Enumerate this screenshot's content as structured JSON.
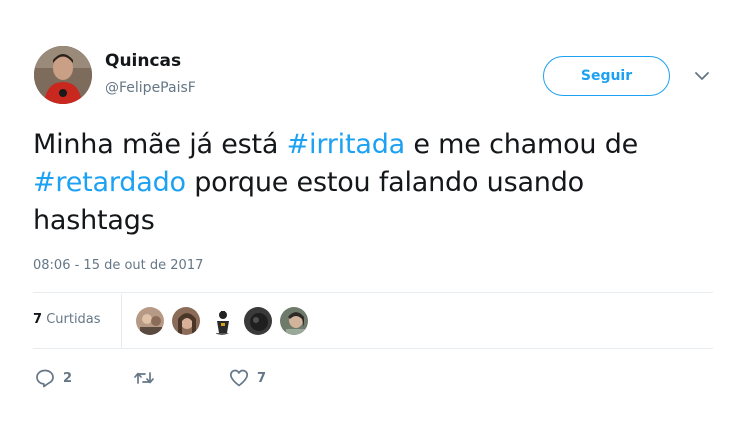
{
  "author": {
    "name": "Quincas",
    "handle": "@FelipePaisF"
  },
  "follow_button": {
    "label": "Seguir"
  },
  "tweet": {
    "text_parts": [
      {
        "text": "Minha mãe já está ",
        "hashtag": false
      },
      {
        "text": "#irritada",
        "hashtag": true
      },
      {
        "text": " e me chamou de ",
        "hashtag": false
      },
      {
        "text": "#retardado",
        "hashtag": true
      },
      {
        "text": " porque estou falando usando hashtags",
        "hashtag": false
      }
    ],
    "timestamp": "08:06 - 15 de out de 2017"
  },
  "stats": {
    "likes_count": "7",
    "likes_label": "Curtidas"
  },
  "likers": [
    {
      "icon": "liker-avatar-1",
      "color": "#b79a86"
    },
    {
      "icon": "liker-avatar-2",
      "color": "#8a6c58"
    },
    {
      "icon": "liker-avatar-3",
      "color": "#ffffff"
    },
    {
      "icon": "liker-avatar-4",
      "color": "#3a3a3a"
    },
    {
      "icon": "liker-avatar-5",
      "color": "#6e7a6a"
    }
  ],
  "actions": {
    "reply_count": "2",
    "retweet_count": "",
    "like_count": "7"
  },
  "colors": {
    "accent": "#1da1f2",
    "muted": "#657786",
    "text": "#14171a",
    "divider": "#e6ecf0"
  }
}
